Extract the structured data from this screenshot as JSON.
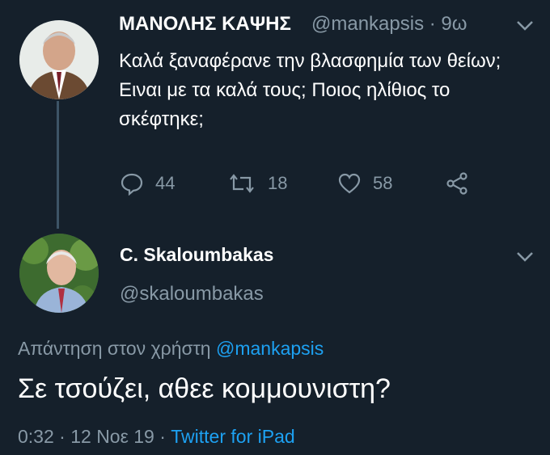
{
  "tweet1": {
    "author_name": "ΜΑΝΟΛΗΣ ΚΑΨΗΣ",
    "handle": "@mankapsis",
    "time": "· 9ω",
    "text": "Καλά ξαναφέρανε την βλασφημία των θείων; Ειναι με τα καλά τους; Ποιος ηλίθιος το σκέφτηκε;",
    "replies": "44",
    "retweets": "18",
    "likes": "58"
  },
  "tweet2": {
    "author_name": "C. Skaloumbakas",
    "handle": "@skaloumbakas",
    "reply_prefix": "Απάντηση στον χρήστη",
    "reply_mention": "@mankapsis",
    "text": "Σε τσούζει, αθεε κομμουνιστη?",
    "time": "0:32",
    "date": "12 Νοε 19",
    "source": "Twitter for iPad"
  },
  "colors": {
    "background": "#15202b",
    "secondary_text": "#8899a6",
    "accent": "#1da1f2"
  }
}
